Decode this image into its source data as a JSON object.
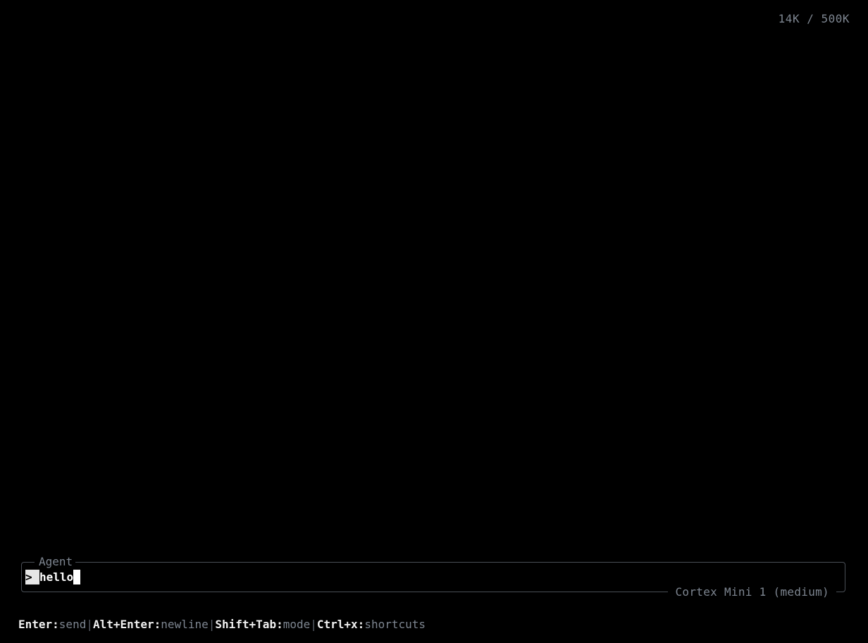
{
  "status": {
    "token_usage": "14K / 500K"
  },
  "input_panel": {
    "title": "Agent",
    "prompt_symbol": ">",
    "value": "hello",
    "model_label": "Cortex Mini 1 (medium)"
  },
  "shortcuts": [
    {
      "key": "Enter:",
      "action": "send"
    },
    {
      "key": "Alt+Enter:",
      "action": "newline"
    },
    {
      "key": "Shift+Tab:",
      "action": "mode"
    },
    {
      "key": "Ctrl+x:",
      "action": "shortcuts"
    }
  ],
  "separator": "|",
  "colors": {
    "background": "#000000",
    "muted_text": "#7d8590",
    "border": "#4a4f57",
    "foreground": "#ffffff"
  }
}
